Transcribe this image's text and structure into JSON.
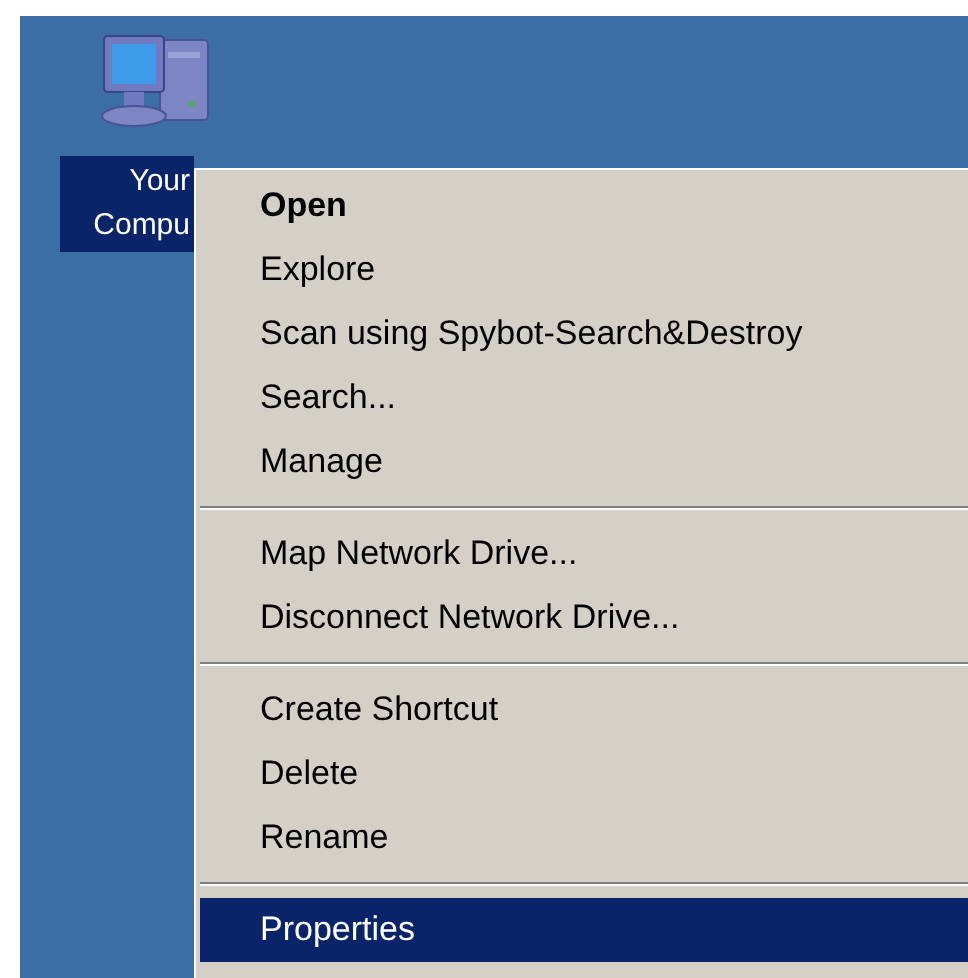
{
  "desktop_icon": {
    "label_lines": [
      "Your",
      "Compu"
    ],
    "selected": true
  },
  "context_menu": {
    "groups": [
      {
        "items": [
          {
            "label": "Open",
            "bold": true,
            "selected": false
          },
          {
            "label": "Explore",
            "bold": false,
            "selected": false
          },
          {
            "label": "Scan using Spybot-Search&Destroy",
            "bold": false,
            "selected": false
          },
          {
            "label": "Search...",
            "bold": false,
            "selected": false
          },
          {
            "label": "Manage",
            "bold": false,
            "selected": false
          }
        ]
      },
      {
        "items": [
          {
            "label": "Map Network Drive...",
            "bold": false,
            "selected": false
          },
          {
            "label": "Disconnect Network Drive...",
            "bold": false,
            "selected": false
          }
        ]
      },
      {
        "items": [
          {
            "label": "Create Shortcut",
            "bold": false,
            "selected": false
          },
          {
            "label": "Delete",
            "bold": false,
            "selected": false
          },
          {
            "label": "Rename",
            "bold": false,
            "selected": false
          }
        ]
      },
      {
        "items": [
          {
            "label": "Properties",
            "bold": false,
            "selected": true
          }
        ]
      }
    ]
  }
}
